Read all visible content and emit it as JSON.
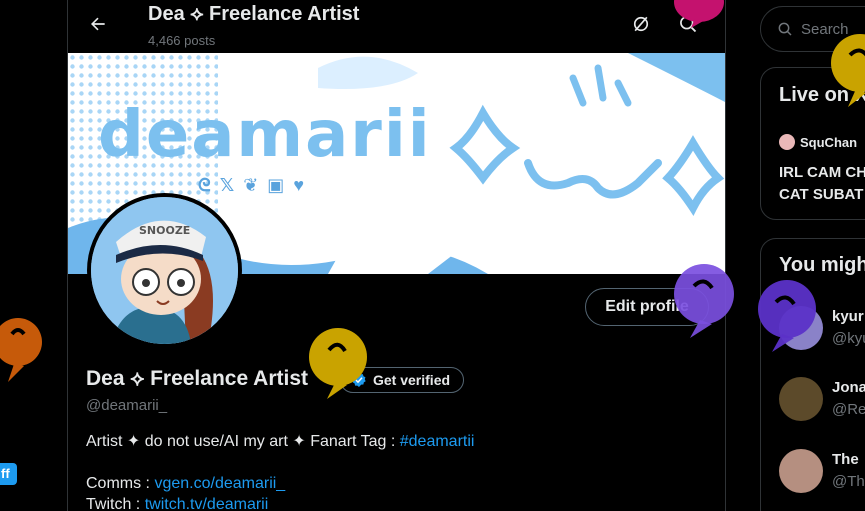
{
  "header": {
    "title": "Dea ⟡ Freelance Artist",
    "posts": "4,466 posts"
  },
  "banner": {
    "wordmark": "deamarii",
    "colors": {
      "light_blue": "#7cc0ef",
      "mid_blue": "#5aa3dd"
    }
  },
  "profile": {
    "name": "Dea ⟡ Freelance Artist",
    "handle": "@deamarii_",
    "edit_label": "Edit profile",
    "verify_label": "Get verified",
    "bio": {
      "line1_text": "Artist ✦ do not use/AI my art ✦ Fanart Tag : ",
      "line1_tag": "#deamartii",
      "comms_label": "Comms : ",
      "comms_link": "vgen.co/deamarii_",
      "twitch_label": "Twitch : ",
      "twitch_link": "twitch.tv/deamarii"
    }
  },
  "left_rail": {
    "pill_text": "ff"
  },
  "sidebar": {
    "search_placeholder": "Search",
    "live": {
      "title": "Live on X",
      "user": "SquChan",
      "line1": "IRL CAM CH",
      "line2": "CAT SUBAT"
    },
    "follow": {
      "title": "You might like",
      "items": [
        {
          "name": "kyur",
          "handle": "@kyu",
          "avatar_color": "#8a82c8"
        },
        {
          "name": "Jona",
          "handle": "@Re",
          "avatar_color": "#5c4a2a"
        },
        {
          "name": "The",
          "handle": "@Th",
          "avatar_color": "#b58f80"
        }
      ]
    }
  },
  "accent": "#1d9bf0"
}
